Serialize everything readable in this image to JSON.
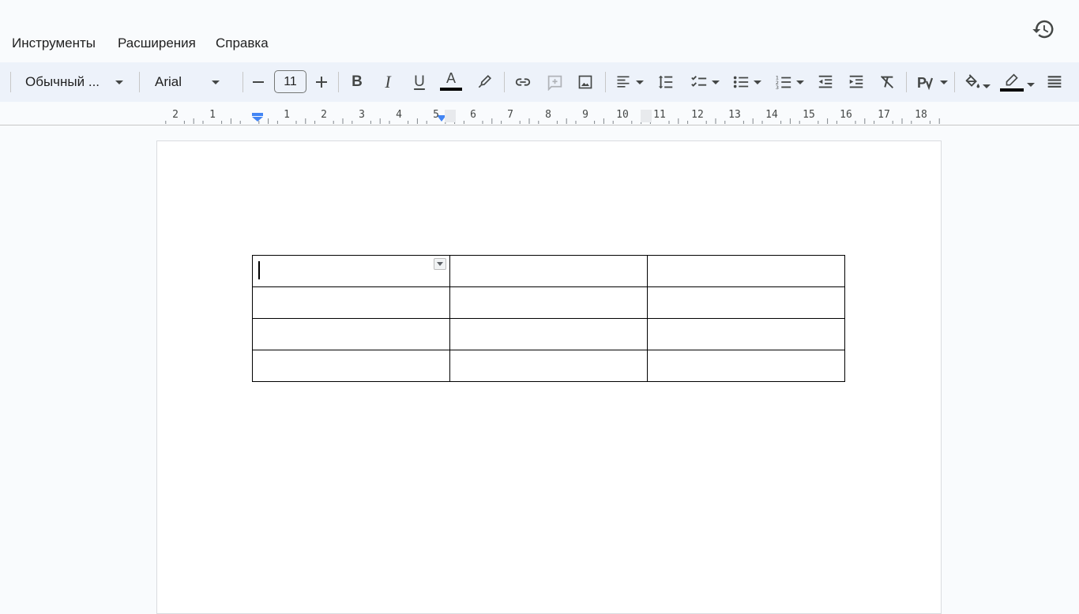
{
  "menu": {
    "items": [
      "Инструменты",
      "Расширения",
      "Справка"
    ]
  },
  "toolbar": {
    "style_dropdown": "Обычный ...",
    "font_dropdown": "Arial",
    "font_size": "11",
    "icons": [
      "minus-icon",
      "plus-icon",
      "bold-icon",
      "italic-icon",
      "underline-icon",
      "text-color-icon",
      "highlight-icon",
      "link-icon",
      "add-comment-icon",
      "image-icon",
      "align-left-icon",
      "line-spacing-icon",
      "checklist-icon",
      "bulleted-list-icon",
      "numbered-list-icon",
      "decrease-indent-icon",
      "increase-indent-icon",
      "clear-formatting-icon",
      "spellcheck-icon",
      "cell-background-icon",
      "border-color-icon",
      "border-width-icon"
    ],
    "bold_label": "B",
    "italic_label": "I",
    "underline_label": "U",
    "text_color_label": "A",
    "colors": {
      "text_color": "#000000",
      "border_color": "#000000",
      "accent": "#4285f4"
    }
  },
  "ruler": {
    "numbers": [
      "2",
      "1",
      "1",
      "2",
      "3",
      "4",
      "5",
      "6",
      "7",
      "8",
      "9",
      "10",
      "11",
      "12",
      "13",
      "14",
      "15",
      "16",
      "17",
      "18"
    ]
  },
  "document": {
    "table": {
      "rows": 4,
      "cols": 3,
      "cells": [
        [
          "",
          "",
          ""
        ],
        [
          "",
          "",
          ""
        ],
        [
          "",
          "",
          ""
        ],
        [
          "",
          "",
          ""
        ]
      ]
    }
  }
}
